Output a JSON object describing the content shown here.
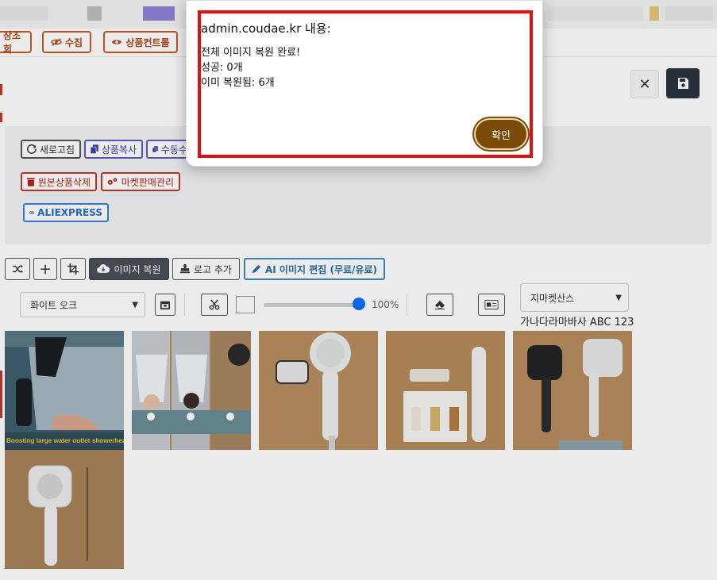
{
  "nav": {
    "items": [
      {
        "label": "상조회",
        "icon": "none"
      },
      {
        "label": "수집",
        "icon": "eye-slash-icon"
      },
      {
        "label": "상품컨트롤",
        "icon": "eye-icon"
      }
    ]
  },
  "actions": {
    "row1": [
      {
        "label": "새로고침",
        "icon": "refresh-icon"
      },
      {
        "label": "상품복사",
        "icon": "copy-icon"
      },
      {
        "label": "수동수",
        "icon": "copy-icon"
      }
    ],
    "row2": [
      {
        "label": "원본상품삭제",
        "icon": "trash-icon"
      },
      {
        "label": "마켓판매관리",
        "icon": "gears-icon"
      }
    ],
    "aliexpress": "ALIEXPRESS"
  },
  "tools": {
    "shuffle": "shuffle-icon",
    "add": "+",
    "crop": "crop-icon",
    "restore_label": "이미지 복원",
    "logo_label": "로고 추가",
    "ai_label": "AI 이미지 편집 (무료/유료)"
  },
  "controls": {
    "bg_select": "화이트 오크",
    "opacity_percent": 100,
    "opacity_label": "100%",
    "font_select": "지마켓산스",
    "sample_text": "가나다라마바사 ABC 123"
  },
  "images": [
    {
      "caption": "Boosting large water outlet showerhead"
    },
    {
      "caption": ""
    },
    {
      "caption": ""
    },
    {
      "caption": ""
    },
    {
      "caption": ""
    },
    {
      "caption": ""
    }
  ],
  "dialog": {
    "title": "admin.coudae.kr 내용:",
    "line1": "전체 이미지 복원 완료!",
    "line2": "성공: 0개",
    "line3": "이미 복원됨: 6개",
    "ok_label": "확인"
  },
  "colors": {
    "nav_accent": "#c9582a",
    "dialog_button": "#7a4b08",
    "highlight_frame": "#e01010",
    "save_button": "#2b3440"
  }
}
